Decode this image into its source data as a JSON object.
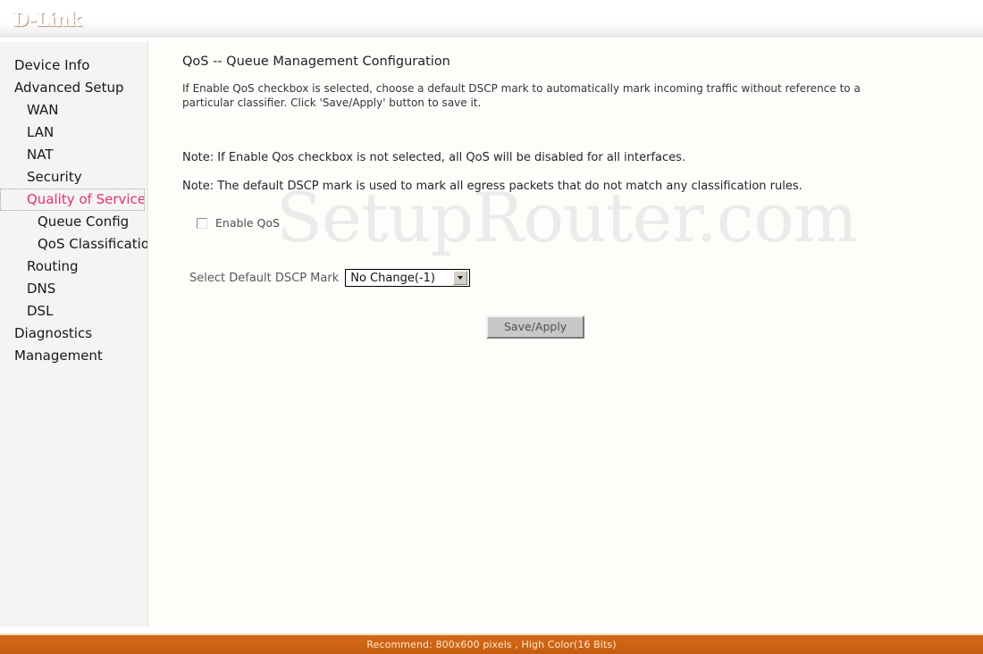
{
  "header": {
    "logo": "D-Link"
  },
  "sidebar": {
    "items": [
      {
        "label": "Device Info",
        "level": 1,
        "active": false
      },
      {
        "label": "Advanced Setup",
        "level": 1,
        "active": false
      },
      {
        "label": "WAN",
        "level": 2,
        "active": false
      },
      {
        "label": "LAN",
        "level": 2,
        "active": false
      },
      {
        "label": "NAT",
        "level": 2,
        "active": false
      },
      {
        "label": "Security",
        "level": 2,
        "active": false
      },
      {
        "label": "Quality of Service",
        "level": 2,
        "active": true
      },
      {
        "label": "Queue Config",
        "level": 3,
        "active": false
      },
      {
        "label": "QoS Classification",
        "level": 3,
        "active": false
      },
      {
        "label": "Routing",
        "level": 2,
        "active": false
      },
      {
        "label": "DNS",
        "level": 2,
        "active": false
      },
      {
        "label": "DSL",
        "level": 2,
        "active": false
      },
      {
        "label": "Diagnostics",
        "level": 1,
        "active": false
      },
      {
        "label": "Management",
        "level": 1,
        "active": false
      }
    ]
  },
  "main": {
    "title": "QoS -- Queue Management Configuration",
    "intro": "If Enable QoS checkbox is selected, choose a default DSCP mark to automatically mark incoming traffic without reference to a particular classifier. Click 'Save/Apply' button to save it.",
    "note1": "Note: If Enable Qos checkbox is not selected, all QoS will be disabled for all interfaces.",
    "note2": "Note: The default DSCP mark is used to mark all egress packets that do not match any classification rules.",
    "enable_qos_label": "Enable QoS",
    "enable_qos_checked": false,
    "dscp_label": "Select Default DSCP Mark",
    "dscp_value": "No Change(-1)",
    "save_button": "Save/Apply",
    "watermark": "SetupRouter.com"
  },
  "footer": {
    "text": "Recommend: 800x600 pixels , High Color(16 Bits)"
  },
  "colors": {
    "brand_orange": "#d2691a",
    "active_item": "#e5326a",
    "sidebar_bg": "#f4f4f4",
    "footer_text": "#ffe9cf"
  }
}
